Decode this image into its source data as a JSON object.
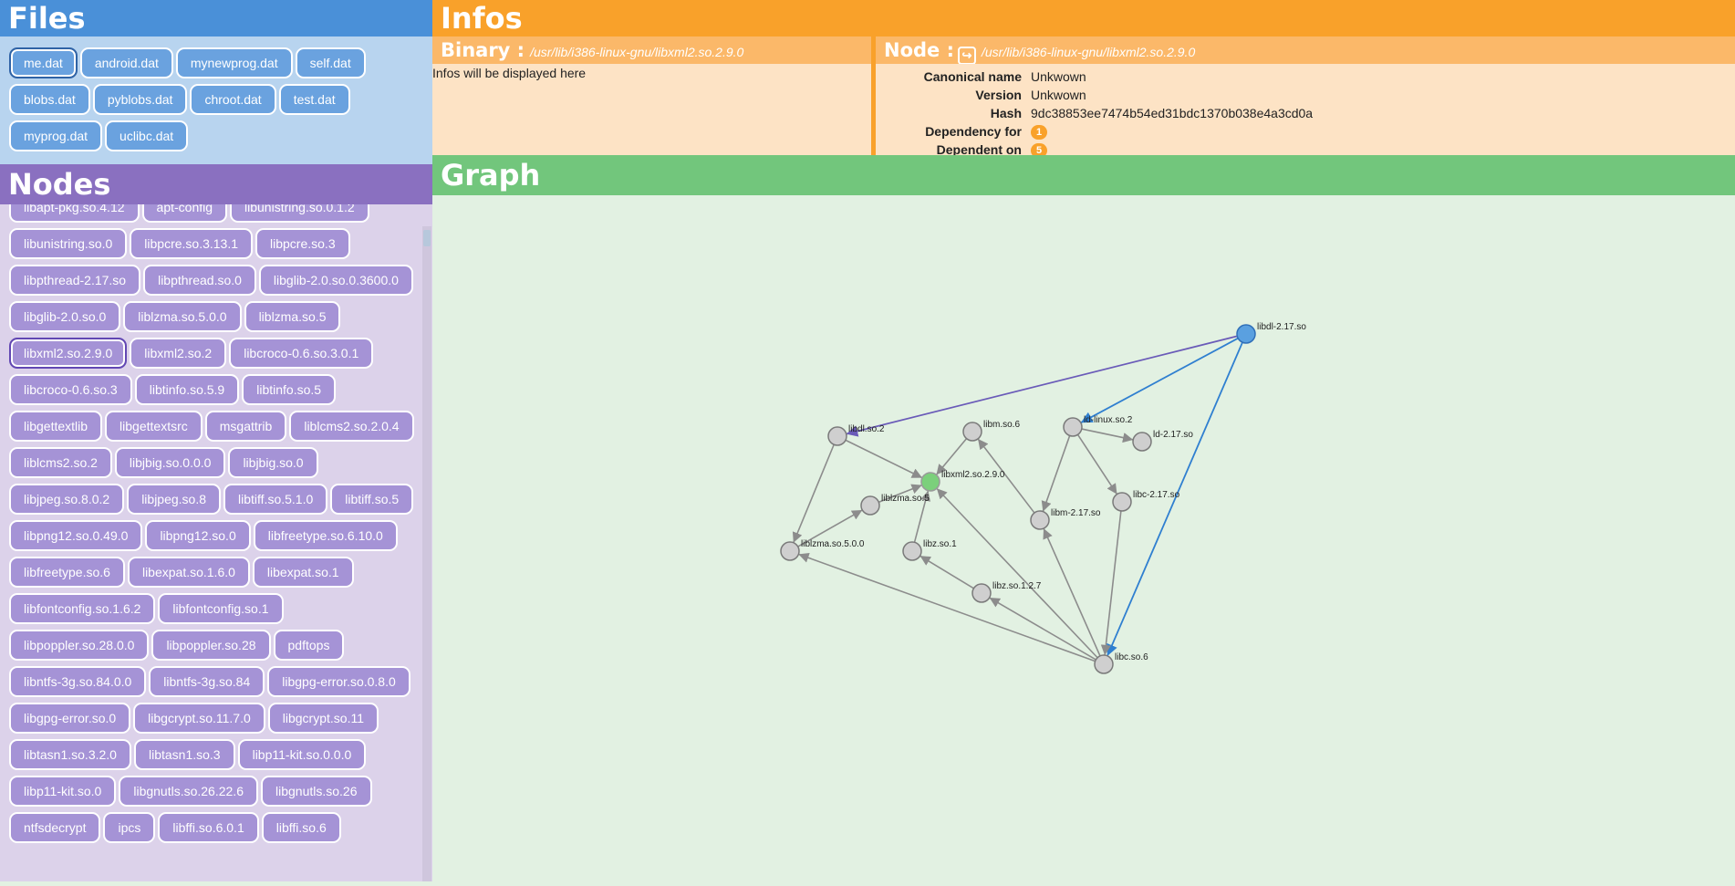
{
  "files": {
    "title": "Files",
    "items": [
      "me.dat",
      "android.dat",
      "mynewprog.dat",
      "self.dat",
      "blobs.dat",
      "pyblobs.dat",
      "chroot.dat",
      "test.dat",
      "myprog.dat",
      "uclibc.dat"
    ],
    "selected": "me.dat"
  },
  "nodes": {
    "title": "Nodes",
    "items": [
      "libapt-pkg.so.4.12",
      "apt-config",
      "libunistring.so.0.1.2",
      "libunistring.so.0",
      "libpcre.so.3.13.1",
      "libpcre.so.3",
      "libpthread-2.17.so",
      "libpthread.so.0",
      "libglib-2.0.so.0.3600.0",
      "libglib-2.0.so.0",
      "liblzma.so.5.0.0",
      "liblzma.so.5",
      "libxml2.so.2.9.0",
      "libxml2.so.2",
      "libcroco-0.6.so.3.0.1",
      "libcroco-0.6.so.3",
      "libtinfo.so.5.9",
      "libtinfo.so.5",
      "libgettextlib",
      "libgettextsrc",
      "msgattrib",
      "liblcms2.so.2.0.4",
      "liblcms2.so.2",
      "libjbig.so.0.0.0",
      "libjbig.so.0",
      "libjpeg.so.8.0.2",
      "libjpeg.so.8",
      "libtiff.so.5.1.0",
      "libtiff.so.5",
      "libpng12.so.0.49.0",
      "libpng12.so.0",
      "libfreetype.so.6.10.0",
      "libfreetype.so.6",
      "libexpat.so.1.6.0",
      "libexpat.so.1",
      "libfontconfig.so.1.6.2",
      "libfontconfig.so.1",
      "libpoppler.so.28.0.0",
      "libpoppler.so.28",
      "pdftops",
      "libntfs-3g.so.84.0.0",
      "libntfs-3g.so.84",
      "libgpg-error.so.0.8.0",
      "libgpg-error.so.0",
      "libgcrypt.so.11.7.0",
      "libgcrypt.so.11",
      "libtasn1.so.3.2.0",
      "libtasn1.so.3",
      "libp11-kit.so.0.0.0",
      "libp11-kit.so.0",
      "libgnutls.so.26.22.6",
      "libgnutls.so.26",
      "ntfsdecrypt",
      "ipcs",
      "libffi.so.6.0.1",
      "libffi.so.6"
    ],
    "selected": "libxml2.so.2.9.0"
  },
  "infos": {
    "title": "Infos",
    "binary": {
      "label": "Binary :",
      "path": "/usr/lib/i386-linux-gnu/libxml2.so.2.9.0",
      "message": "Infos will be displayed here"
    },
    "node": {
      "label": "Node :",
      "link_icon": "symlink-icon",
      "path": "/usr/lib/i386-linux-gnu/libxml2.so.2.9.0",
      "canonical_name_label": "Canonical name",
      "canonical_name": "Unkwown",
      "version_label": "Version",
      "version": "Unkwown",
      "hash_label": "Hash",
      "hash": "9dc38853ee7474b54ed31bdc1370b038e4a3cd0a",
      "dependency_for_label": "Dependency for",
      "dependency_for": "1",
      "dependent_on_label": "Dependent on",
      "dependent_on": "5"
    }
  },
  "graph": {
    "title": "Graph",
    "nodes": [
      {
        "id": "libdl-2.17.so",
        "kind": "source"
      },
      {
        "id": "libdl.so.2",
        "kind": "normal"
      },
      {
        "id": "libm.so.6",
        "kind": "normal"
      },
      {
        "id": "ld-linux.so.2",
        "kind": "normal"
      },
      {
        "id": "ld-2.17.so",
        "kind": "normal"
      },
      {
        "id": "libxml2.so.2.9.0",
        "kind": "selected"
      },
      {
        "id": "liblzma.so.5",
        "kind": "normal"
      },
      {
        "id": "libc-2.17.so",
        "kind": "normal"
      },
      {
        "id": "libm-2.17.so",
        "kind": "normal"
      },
      {
        "id": "liblzma.so.5.0.0",
        "kind": "normal"
      },
      {
        "id": "libz.so.1",
        "kind": "normal"
      },
      {
        "id": "libz.so.1.2.7",
        "kind": "normal"
      },
      {
        "id": "libc.so.6",
        "kind": "normal"
      }
    ],
    "edges": [
      {
        "source": "libdl-2.17.so",
        "target": "libdl.so.2",
        "kind": "dependency"
      },
      {
        "source": "libdl-2.17.so",
        "target": "ld-linux.so.2",
        "kind": "highlight"
      },
      {
        "source": "libdl-2.17.so",
        "target": "libc.so.6",
        "kind": "highlight"
      },
      {
        "source": "libdl.so.2",
        "target": "libxml2.so.2.9.0",
        "kind": "normal"
      },
      {
        "source": "libm.so.6",
        "target": "libxml2.so.2.9.0",
        "kind": "normal"
      },
      {
        "source": "liblzma.so.5",
        "target": "libxml2.so.2.9.0",
        "kind": "normal"
      },
      {
        "source": "libz.so.1",
        "target": "libxml2.so.2.9.0",
        "kind": "normal"
      },
      {
        "source": "libc.so.6",
        "target": "libxml2.so.2.9.0",
        "kind": "normal"
      },
      {
        "source": "liblzma.so.5.0.0",
        "target": "liblzma.so.5",
        "kind": "normal"
      },
      {
        "source": "libdl.so.2",
        "target": "liblzma.so.5.0.0",
        "kind": "normal"
      },
      {
        "source": "libc.so.6",
        "target": "liblzma.so.5.0.0",
        "kind": "normal"
      },
      {
        "source": "libz.so.1.2.7",
        "target": "libz.so.1",
        "kind": "normal"
      },
      {
        "source": "libc.so.6",
        "target": "libz.so.1.2.7",
        "kind": "normal"
      },
      {
        "source": "libm-2.17.so",
        "target": "libm.so.6",
        "kind": "normal"
      },
      {
        "source": "libc.so.6",
        "target": "libm-2.17.so",
        "kind": "normal"
      },
      {
        "source": "ld-linux.so.2",
        "target": "libm-2.17.so",
        "kind": "normal"
      },
      {
        "source": "ld-linux.so.2",
        "target": "libc-2.17.so",
        "kind": "normal"
      },
      {
        "source": "ld-linux.so.2",
        "target": "ld-2.17.so",
        "kind": "normal"
      },
      {
        "source": "libc-2.17.so",
        "target": "libc.so.6",
        "kind": "normal"
      }
    ]
  },
  "colors": {
    "files": "#4a90d8",
    "nodes": "#8a70c0",
    "infos": "#f9a12a",
    "graph": "#72c67c",
    "edge_normal": "#8c8c8c",
    "edge_dependency": "#6a5bb8",
    "edge_highlight": "#2f7fd0",
    "node_fill": "#cfcfcf",
    "node_source": "#5aa0e0",
    "node_selected": "#7bd07b"
  }
}
